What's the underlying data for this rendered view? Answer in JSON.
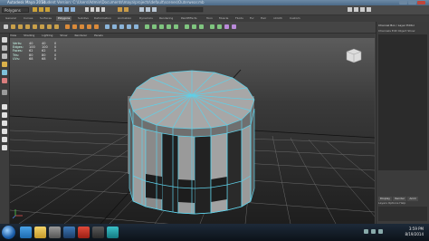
{
  "window": {
    "title": "Autodesk Maya 2014",
    "subtitle": "Student Version: C:\\Users\\Admin\\Documents\\maya\\projects\\default\\scenes\\Outerwear.mb"
  },
  "menubar": {
    "mode": "Polygons"
  },
  "shelf_tabs": [
    "General",
    "Curves",
    "Surfaces",
    "Polygons",
    "Subdivs",
    "Deformation",
    "Animation",
    "Dynamics",
    "Rendering",
    "PaintEffects",
    "Toon",
    "Muscle",
    "Fluids",
    "Fur",
    "Hair",
    "nCloth",
    "Custom"
  ],
  "panel_menu": [
    "View",
    "Shading",
    "Lighting",
    "Show",
    "Renderer",
    "Panels"
  ],
  "hud_stats": [
    {
      "label": "Verts:",
      "values": [
        "40",
        "40",
        "0"
      ]
    },
    {
      "label": "Edges:",
      "values": [
        "100",
        "100",
        "0"
      ]
    },
    {
      "label": "Faces:",
      "values": [
        "62",
        "62",
        "0"
      ]
    },
    {
      "label": "Tris:",
      "values": [
        "80",
        "80",
        "0"
      ]
    },
    {
      "label": "UVs:",
      "values": [
        "68",
        "68",
        "0"
      ]
    }
  ],
  "channel_box": {
    "header": "Channel Box / Layer Editor",
    "menu": "Channels Edit Object Show"
  },
  "layer_editor": {
    "tabs": [
      "Display",
      "Render",
      "Anim"
    ],
    "menu": "Layers Options Help"
  },
  "taskbar": {
    "time": "3:59 PM",
    "date": "8/19/2014"
  },
  "colors": {
    "accent": "#5fd0e8",
    "wireframe": "#5fd0e8",
    "model_face": "#a7a7a7"
  }
}
